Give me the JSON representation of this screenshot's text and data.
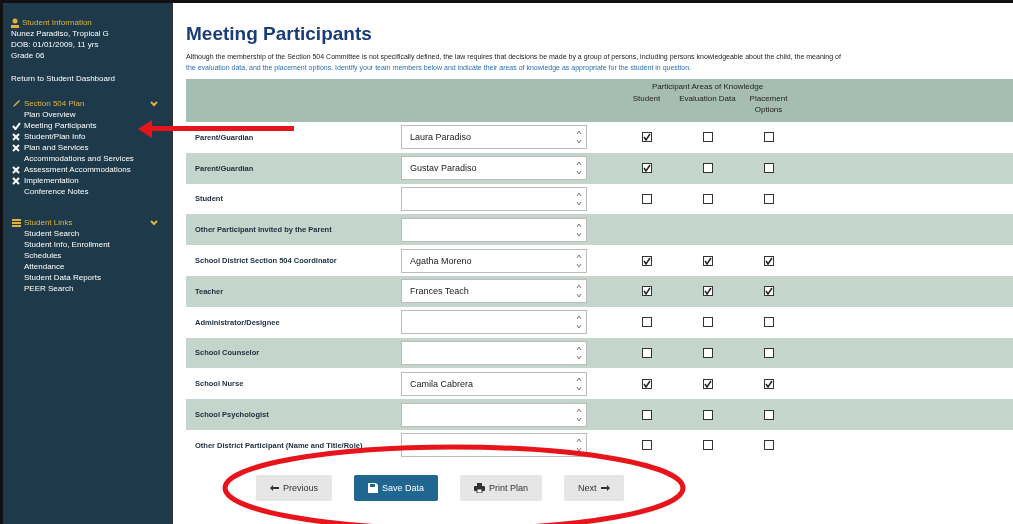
{
  "sidebar": {
    "student_heading": "Student Information",
    "student_name": "Nunez Paradiso, Tropical G",
    "student_details": "DOB: 01/01/2009, 11 yrs",
    "student_grade": "Grade 06",
    "dashboard_link": "Return to Student Dashboard",
    "sections": [
      {
        "title": "Section 504 Plan",
        "kind": "plan",
        "expanded": true,
        "items": [
          {
            "label": "Plan Overview",
            "kind": "plain"
          },
          {
            "label": "Meeting Participants",
            "kind": "done"
          },
          {
            "label": "Student/Plan Info",
            "kind": "todo"
          },
          {
            "label": "Plan and Services",
            "kind": "todo"
          },
          {
            "label": "Accommodations and Services",
            "kind": "plain"
          },
          {
            "label": "Assessment Accommodations",
            "kind": "todo"
          },
          {
            "label": "Implementation",
            "kind": "todo"
          },
          {
            "label": "Conference Notes",
            "kind": "plain"
          }
        ]
      },
      {
        "title": "Student Links",
        "kind": "links",
        "expanded": true,
        "items": [
          {
            "label": "Student Search",
            "kind": "plain"
          },
          {
            "label": "Student Info, Enrollment",
            "kind": "plain"
          },
          {
            "label": "Schedules",
            "kind": "plain"
          },
          {
            "label": "Attendance",
            "kind": "plain"
          },
          {
            "label": "Student Data Reports",
            "kind": "plain"
          },
          {
            "label": "PEER Search",
            "kind": "plain"
          }
        ]
      }
    ]
  },
  "page": {
    "title": "Meeting Participants",
    "intro": "Although the membership of the Section 504 Committee is not specifically defined, the law requires that decisions be made by a group of persons, including persons knowledgeable about the child, the meaning of",
    "intro_link": "the evaluation data, and the placement options. Identify your team members below and indicate their areas of knowledge as appropriate for the student in question."
  },
  "table": {
    "group_heading": "Participant Areas of Knowledge",
    "columns": [
      "Student",
      "Evaluation Data",
      "Placement Options"
    ],
    "rows": [
      {
        "role": "Parent/Guardian",
        "name": "Laura Paradiso",
        "knowledge": [
          {
            "checked": true
          },
          {
            "checked": false
          },
          {
            "checked": false
          }
        ]
      },
      {
        "role": "Parent/Guardian",
        "name": "Gustav Paradiso",
        "knowledge": [
          {
            "checked": true
          },
          {
            "checked": false
          },
          {
            "checked": false
          }
        ]
      },
      {
        "role": "Student",
        "knowledge": [
          {
            "checked": false
          },
          {
            "checked": false
          },
          {
            "checked": false
          }
        ]
      },
      {
        "role": "Other Participant Invited by the Parent"
      },
      {
        "role": "School District Section 504 Coordinator",
        "name": "Agatha Moreno",
        "knowledge": [
          {
            "checked": true
          },
          {
            "checked": true
          },
          {
            "checked": true
          }
        ]
      },
      {
        "role": "Teacher",
        "name": "Frances Teach",
        "knowledge": [
          {
            "checked": true
          },
          {
            "checked": true
          },
          {
            "checked": true
          }
        ]
      },
      {
        "role": "Administrator/Designee",
        "knowledge": [
          {
            "checked": false
          },
          {
            "checked": false
          },
          {
            "checked": false
          }
        ]
      },
      {
        "role": "School Counselor",
        "knowledge": [
          {
            "checked": false
          },
          {
            "checked": false
          },
          {
            "checked": false
          }
        ]
      },
      {
        "role": "School Nurse",
        "name": "Camila Cabrera",
        "knowledge": [
          {
            "checked": true
          },
          {
            "checked": true
          },
          {
            "checked": true
          }
        ]
      },
      {
        "role": "School Psychologist",
        "knowledge": [
          {
            "checked": false
          },
          {
            "checked": false
          },
          {
            "checked": false
          }
        ]
      },
      {
        "role": "Other District Participant (Name and Title/Role)",
        "knowledge": [
          {
            "checked": false
          },
          {
            "checked": false
          },
          {
            "checked": false
          }
        ]
      }
    ]
  },
  "buttons": [
    {
      "label": "Previous",
      "kind": "previous"
    },
    {
      "label": "Save Data",
      "kind": "save"
    },
    {
      "label": "Print Plan",
      "kind": "print"
    },
    {
      "label": "Next",
      "kind": "next"
    }
  ]
}
